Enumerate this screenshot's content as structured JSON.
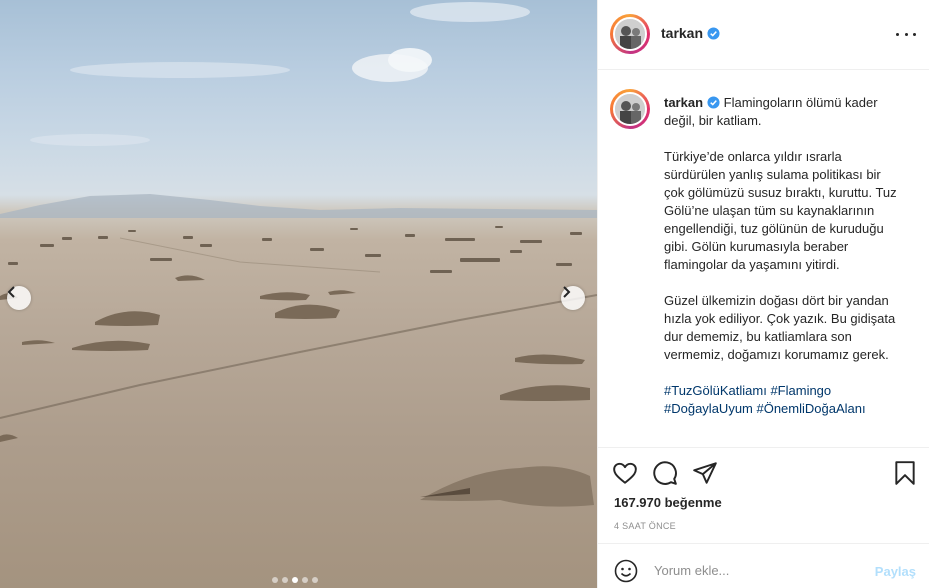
{
  "post": {
    "username": "tarkan",
    "verified": true,
    "caption": {
      "first": "Flamingoların ölümü kader değil, bir katliam.",
      "para1": "Türkiye’de onlarca yıldır ısrarla sürdürülen yanlış sulama politikası bir çok gölümüzü susuz bıraktı, kuruttu. Tuz Gölü’ne ulaşan tüm su kaynaklarının engellendiği, tuz gölünün de kuruduğu gibi. Gölün kurumasıyla beraber flamingolar da yaşamını yitirdi.",
      "para2": "Güzel ülkemizin doğası dört bir yandan hızla yok ediliyor. Çok yazık. Bu gidişata dur dememiz, bu katliamlara son vermemiz, doğamızı korumamız gerek.",
      "hashtags_line1": "#TuzGölüKatliamı #Flamingo",
      "hashtags_line2": "#DoğaylaUyum #ÖnemliDoğaAlanı"
    },
    "likes": "167.970 beğenme",
    "time_ago": "4 SAAT ÖNCE"
  },
  "carousel": {
    "total": 5,
    "active_index": 2
  },
  "comment_box": {
    "placeholder": "Yorum ekle...",
    "share_label": "Paylaş"
  },
  "icons": {
    "like": "heart-icon",
    "comment": "comment-bubble-icon",
    "share": "paper-plane-icon",
    "save": "bookmark-icon",
    "more": "more-options-icon",
    "emoji": "emoji-smiley-icon",
    "verified": "verified-badge-icon",
    "prev": "chevron-left-icon",
    "next": "chevron-right-icon"
  },
  "colors": {
    "accent_link": "#00376b",
    "verified_blue": "#3897f0",
    "share_disabled": "#b2dffc"
  }
}
